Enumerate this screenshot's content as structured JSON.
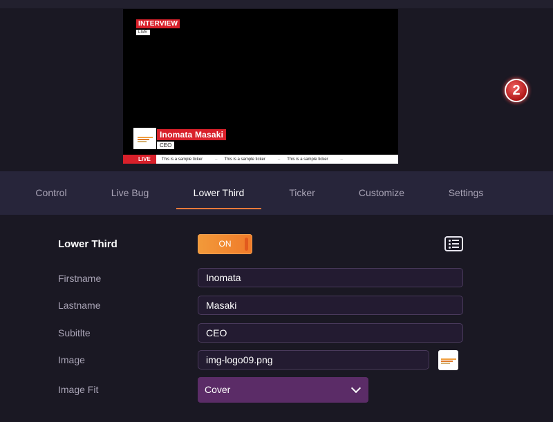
{
  "preview": {
    "bug_title": "INTERVIEW",
    "bug_live": "LIVE",
    "lower_third_name": "Inomata Masaki",
    "lower_third_subtitle": "CEO",
    "ticker_live": "LIVE",
    "ticker_items": [
      "This is a sample ticker",
      "This is a sample ticker",
      "This is a sample ticker"
    ]
  },
  "tabs": [
    {
      "label": "Control",
      "active": false
    },
    {
      "label": "Live Bug",
      "active": false
    },
    {
      "label": "Lower Third",
      "active": true
    },
    {
      "label": "Ticker",
      "active": false
    },
    {
      "label": "Customize",
      "active": false
    },
    {
      "label": "Settings",
      "active": false
    }
  ],
  "panel": {
    "title": "Lower Third",
    "toggle_label": "ON",
    "list_icon": "list-icon",
    "fields": {
      "firstname": {
        "label": "Firstname",
        "value": "Inomata"
      },
      "lastname": {
        "label": "Lastname",
        "value": "Masaki"
      },
      "subtitle": {
        "label": "Subitlte",
        "value": "CEO"
      },
      "image": {
        "label": "Image",
        "value": "img-logo09.png"
      },
      "image_fit": {
        "label": "Image Fit",
        "value": "Cover"
      }
    }
  },
  "step_badge": "2",
  "colors": {
    "accent": "#f07a3a",
    "live_red": "#d8202a",
    "select_bg": "#5b2c67",
    "background": "#1a1823",
    "tabbar_bg": "#27253a"
  }
}
